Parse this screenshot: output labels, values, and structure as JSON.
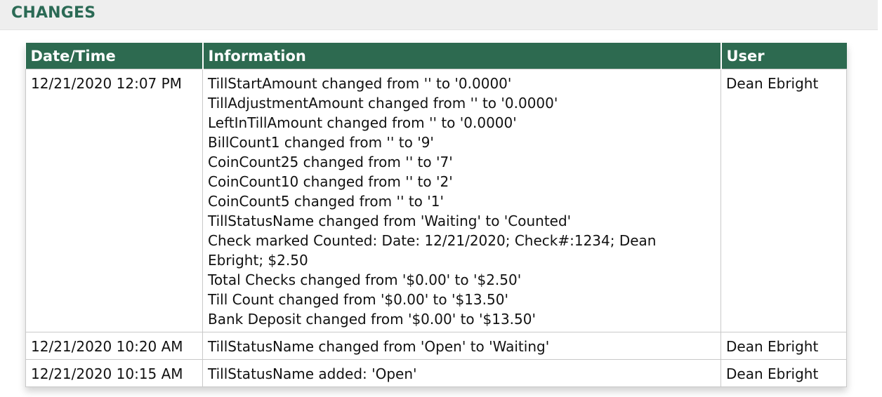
{
  "section": {
    "title": "CHANGES"
  },
  "table": {
    "headers": [
      "Date/Time",
      "Information",
      "User"
    ],
    "rows": [
      {
        "datetime": "12/21/2020 12:07 PM",
        "info": [
          "TillStartAmount changed from '' to '0.0000'",
          "TillAdjustmentAmount changed from '' to '0.0000'",
          "LeftInTillAmount changed from '' to '0.0000'",
          "BillCount1 changed from '' to '9'",
          "CoinCount25 changed from '' to '7'",
          "CoinCount10 changed from '' to '2'",
          "CoinCount5 changed from '' to '1'",
          "TillStatusName changed from 'Waiting' to 'Counted'",
          "Check marked Counted: Date: 12/21/2020; Check#:1234; Dean Ebright; $2.50",
          "Total Checks changed from '$0.00' to '$2.50'",
          "Till Count changed from '$0.00' to '$13.50'",
          "Bank Deposit changed from '$0.00' to '$13.50'"
        ],
        "user": "Dean Ebright"
      },
      {
        "datetime": "12/21/2020 10:20 AM",
        "info": [
          "TillStatusName changed from 'Open' to 'Waiting'"
        ],
        "user": "Dean Ebright"
      },
      {
        "datetime": "12/21/2020 10:15 AM",
        "info": [
          "TillStatusName added: 'Open'"
        ],
        "user": "Dean Ebright"
      }
    ]
  }
}
